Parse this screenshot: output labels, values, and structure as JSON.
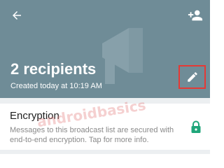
{
  "header": {
    "title": "2 recipients",
    "subtitle": "Created today at 10:19 AM",
    "background_color": "#6f8c97",
    "icons": {
      "back": "arrow-back-icon",
      "add_recipient": "person-add-icon",
      "edit": "pencil-icon",
      "watermark": "broadcast-megaphone-icon"
    }
  },
  "encryption": {
    "title": "Encryption",
    "description": "Messages to this broadcast list are secured with end-to-end encryption. Tap for more info.",
    "icon": "lock-icon",
    "icon_color": "#1fa67a"
  },
  "watermark_text": "androidbasics",
  "highlight_color": "#e53935"
}
